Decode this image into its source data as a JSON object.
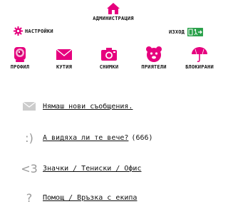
{
  "header": {
    "admin_label": "АДМИНИСТРАЦИЯ",
    "settings_label": "НАСТРОЙКИ",
    "logout_label": "ИЗХОД"
  },
  "nav": {
    "items": [
      {
        "label": "ПРОФИЛ",
        "icon": "webcam-icon"
      },
      {
        "label": "КУТИЯ",
        "icon": "envelope-icon"
      },
      {
        "label": "СНИМКИ",
        "icon": "camera-icon"
      },
      {
        "label": "ПРИЯТЕЛИ",
        "icon": "bear-face-icon"
      },
      {
        "label": "БЛОКИРАНИ",
        "icon": "umbrella-icon"
      }
    ]
  },
  "messages": {
    "no_messages": "Нямаш нови съобщения.",
    "seen": "А видяха ли те вече?",
    "seen_count": "(666)",
    "badges": "Значки / Тениски / Офис",
    "help": "Помощ / Връзка с екипа",
    "sym_smile": ":)",
    "sym_heart": "<3",
    "sym_help": "?"
  },
  "colors": {
    "accent": "#e6007e",
    "exit_green": "#2ba14b",
    "muted": "#999999"
  }
}
